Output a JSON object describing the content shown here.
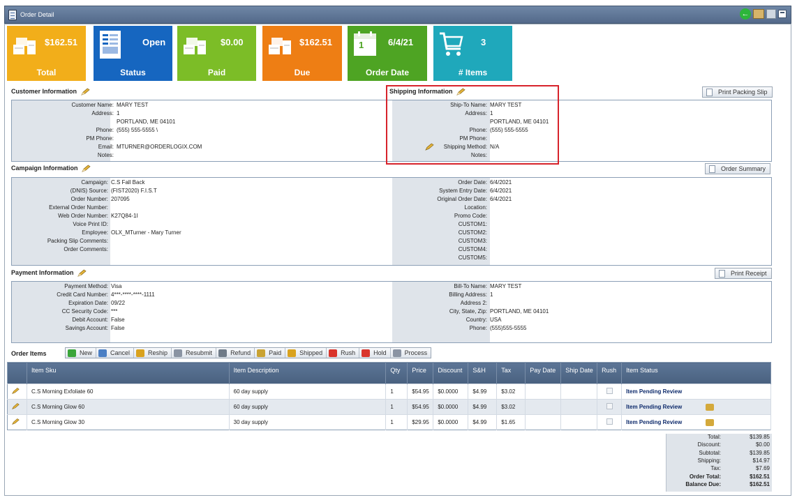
{
  "window": {
    "title": "Order Detail"
  },
  "tiles": [
    {
      "value": "$162.51",
      "label": "Total",
      "color": "#f2ae1a",
      "icon": "money-stack-icon"
    },
    {
      "value": "Open",
      "label": "Status",
      "color": "#1666c0",
      "icon": "document-form-icon"
    },
    {
      "value": "$0.00",
      "label": "Paid",
      "color": "#7cbd27",
      "icon": "money-stack-icon"
    },
    {
      "value": "$162.51",
      "label": "Due",
      "color": "#ee7e14",
      "icon": "money-stack-icon"
    },
    {
      "value": "6/4/21",
      "label": "Order Date",
      "color": "#4ea423",
      "icon": "calendar-icon",
      "calendar_day": "1"
    },
    {
      "value": "3",
      "label": "# Items",
      "color": "#1fa8bb",
      "icon": "shopping-cart-icon"
    }
  ],
  "customer": {
    "title": "Customer Information",
    "fields": [
      {
        "k": "Customer Name:",
        "v": "MARY TEST"
      },
      {
        "k": "Address:",
        "v": "1"
      },
      {
        "k": "",
        "v": "PORTLAND, ME 04101"
      },
      {
        "k": "Phone:",
        "v": "(555) 555-5555 \\"
      },
      {
        "k": "PM Phone:",
        "v": ""
      },
      {
        "k": "Email:",
        "v": "MTURNER@ORDERLOGIX.COM"
      },
      {
        "k": "Notes:",
        "v": ""
      }
    ]
  },
  "shipping": {
    "title": "Shipping Information",
    "print_label": "Print Packing Slip",
    "fields": [
      {
        "k": "Ship-To Name:",
        "v": "MARY TEST"
      },
      {
        "k": "Address:",
        "v": "1"
      },
      {
        "k": "",
        "v": "PORTLAND, ME 04101"
      },
      {
        "k": "Phone:",
        "v": "(555) 555-5555"
      },
      {
        "k": "PM Phone:",
        "v": ""
      },
      {
        "k": "Shipping Method:",
        "v": "N/A"
      },
      {
        "k": "Notes:",
        "v": ""
      }
    ]
  },
  "campaign": {
    "title": "Campaign Information",
    "summary_label": "Order Summary",
    "left": [
      {
        "k": "Campaign:",
        "v": "C.S Fall Back"
      },
      {
        "k": "(DNIS) Source:",
        "v": "(FIST2020) F.I.S.T"
      },
      {
        "k": "Order Number:",
        "v": "207095"
      },
      {
        "k": "External Order Number:",
        "v": ""
      },
      {
        "k": "Web Order Number:",
        "v": "K27Q84-1I"
      },
      {
        "k": "Voice Print ID:",
        "v": ""
      },
      {
        "k": "Employee:",
        "v": "OLX_MTurner - Mary Turner"
      },
      {
        "k": "Packing Slip Comments:",
        "v": ""
      },
      {
        "k": "Order Comments:",
        "v": ""
      }
    ],
    "right": [
      {
        "k": "Order Date:",
        "v": "6/4/2021"
      },
      {
        "k": "System Entry Date:",
        "v": "6/4/2021"
      },
      {
        "k": "Original Order Date:",
        "v": "6/4/2021"
      },
      {
        "k": "Location:",
        "v": ""
      },
      {
        "k": "Promo Code:",
        "v": ""
      },
      {
        "k": "CUSTOM1:",
        "v": ""
      },
      {
        "k": "CUSTOM2:",
        "v": ""
      },
      {
        "k": "CUSTOM3:",
        "v": ""
      },
      {
        "k": "CUSTOM4:",
        "v": ""
      },
      {
        "k": "CUSTOM5:",
        "v": ""
      }
    ]
  },
  "payment": {
    "title": "Payment Information",
    "print_label": "Print Receipt",
    "left": [
      {
        "k": "Payment Method:",
        "v": "Visa"
      },
      {
        "k": "Credit Card Number:",
        "v": "4***-****-****-1111"
      },
      {
        "k": "Expiration Date:",
        "v": "09/22"
      },
      {
        "k": "CC Security Code:",
        "v": "***"
      },
      {
        "k": "Debit Account:",
        "v": "False"
      },
      {
        "k": "Savings Account:",
        "v": "False"
      }
    ],
    "right": [
      {
        "k": "Bill-To Name:",
        "v": "MARY TEST"
      },
      {
        "k": "Billing Address:",
        "v": "1"
      },
      {
        "k": "Address 2:",
        "v": ""
      },
      {
        "k": "City, State, Zip:",
        "v": "PORTLAND, ME 04101"
      },
      {
        "k": "Country:",
        "v": "USA"
      },
      {
        "k": "Phone:",
        "v": "(555)555-5555"
      }
    ]
  },
  "order_items": {
    "title": "Order Items",
    "toolbar": [
      {
        "label": "New",
        "icon": "plus-icon",
        "color": "#3aa53a"
      },
      {
        "label": "Cancel",
        "icon": "cancel-icon",
        "color": "#4b7fc4"
      },
      {
        "label": "Reship",
        "icon": "reship-icon",
        "color": "#d9a21e"
      },
      {
        "label": "Resubmit",
        "icon": "resubmit-icon",
        "color": "#8a94a3"
      },
      {
        "label": "Refund",
        "icon": "refund-icon",
        "color": "#6f7b88"
      },
      {
        "label": "Paid",
        "icon": "paid-icon",
        "color": "#c9a232"
      },
      {
        "label": "Shipped",
        "icon": "shipped-icon",
        "color": "#d9a21e"
      },
      {
        "label": "Rush",
        "icon": "rush-icon",
        "color": "#d9342b"
      },
      {
        "label": "Hold",
        "icon": "flag-icon",
        "color": "#d9342b"
      },
      {
        "label": "Process",
        "icon": "process-icon",
        "color": "#8a94a3"
      }
    ],
    "columns": [
      "Item Sku",
      "Item Description",
      "Qty",
      "Price",
      "Discount",
      "S&H",
      "Tax",
      "Pay Date",
      "Ship Date",
      "Rush",
      "Item Status"
    ],
    "rows": [
      {
        "sku": "C.S Morning Exfoliate 60",
        "desc": "60 day supply",
        "qty": "1",
        "price": "$54.95",
        "discount": "$0.0000",
        "sh": "$4.99",
        "tax": "$3.02",
        "pay_date": "",
        "ship_date": "",
        "status": "Item Pending Review",
        "truck": false
      },
      {
        "sku": "C.S Morning Glow 60",
        "desc": "60 day supply",
        "qty": "1",
        "price": "$54.95",
        "discount": "$0.0000",
        "sh": "$4.99",
        "tax": "$3.02",
        "pay_date": "",
        "ship_date": "",
        "status": "Item Pending Review",
        "truck": true
      },
      {
        "sku": "C.S Morning Glow 30",
        "desc": "30 day supply",
        "qty": "1",
        "price": "$29.95",
        "discount": "$0.0000",
        "sh": "$4.99",
        "tax": "$1.65",
        "pay_date": "",
        "ship_date": "",
        "status": "Item Pending Review",
        "truck": true
      }
    ]
  },
  "totals": [
    {
      "k": "Total:",
      "v": "$139.85",
      "bold": false
    },
    {
      "k": "Discount:",
      "v": "$0.00",
      "bold": false
    },
    {
      "k": "Subtotal:",
      "v": "$139.85",
      "bold": false
    },
    {
      "k": "Shipping:",
      "v": "$14.97",
      "bold": false
    },
    {
      "k": "Tax:",
      "v": "$7.69",
      "bold": false
    },
    {
      "k": "Order Total:",
      "v": "$162.51",
      "bold": true
    },
    {
      "k": "Balance Due:",
      "v": "$162.51",
      "bold": true
    }
  ]
}
